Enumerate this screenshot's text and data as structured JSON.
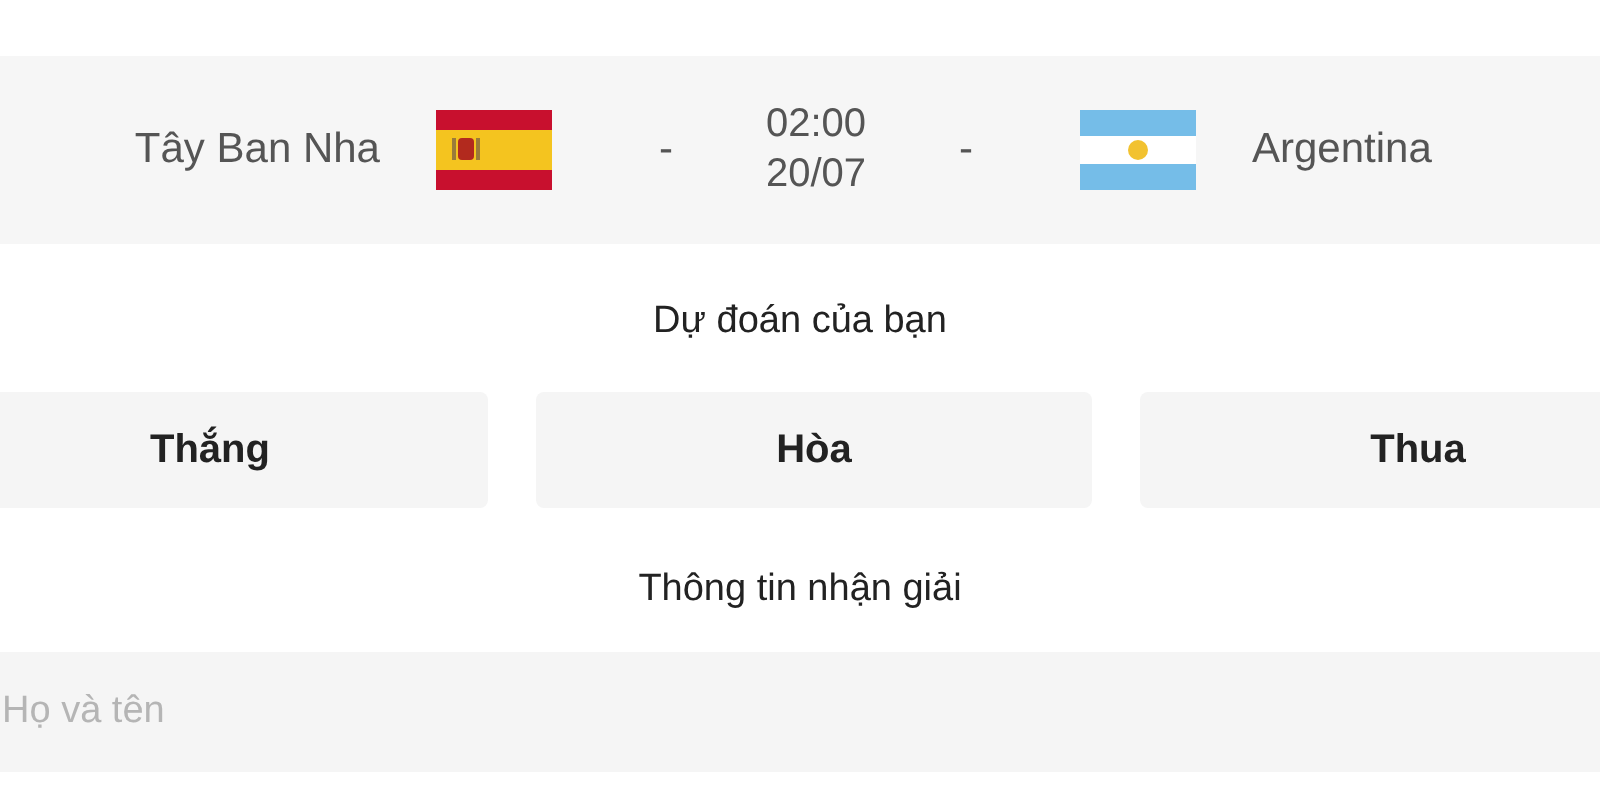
{
  "match": {
    "home": {
      "name": "Tây Ban Nha"
    },
    "separator_left": "-",
    "time": "02:00",
    "date": "20/07",
    "separator_right": "-",
    "away": {
      "name": "Argentina"
    }
  },
  "prediction": {
    "title": "Dự đoán của bạn",
    "options": [
      {
        "label": "Thắng",
        "selected": false
      },
      {
        "label": "Hòa",
        "selected": false
      },
      {
        "label": "Thua",
        "selected": false
      }
    ]
  },
  "prize_info": {
    "title": "Thông tin nhận giải",
    "name_field": {
      "placeholder": "Họ và tên"
    }
  }
}
